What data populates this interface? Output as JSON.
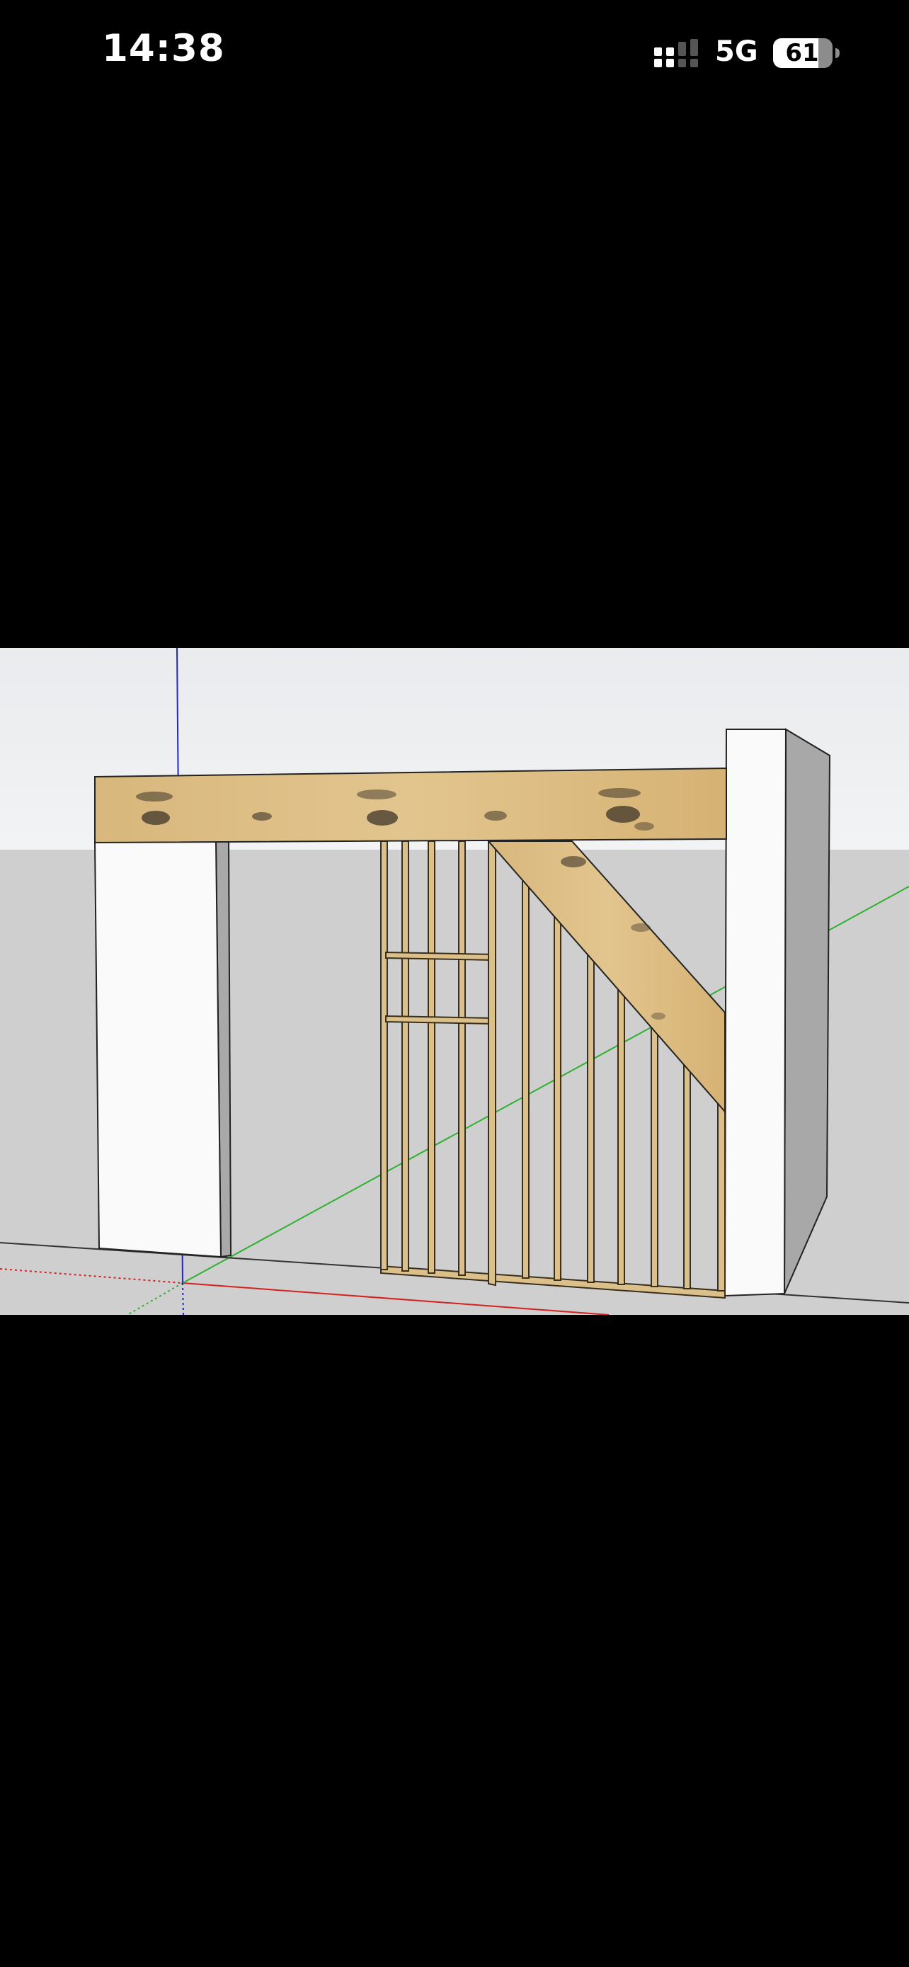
{
  "status_bar": {
    "time": "14:38",
    "network": "5G",
    "battery_level": "61",
    "signal_icon": "signal-bars-icon",
    "battery_icon": "battery-icon"
  },
  "viewport": {
    "content": "3d-model-view",
    "colors": {
      "sky": "#eceef0",
      "ground": "#cfcfcf",
      "wall_front": "#fafafa",
      "wall_side": "#a8a8a8",
      "timber": "#dcbd84",
      "timber_dark": "#c8a266",
      "axis_red": "#d42020",
      "axis_green": "#2fb02f",
      "axis_blue": "#2323dd"
    }
  }
}
